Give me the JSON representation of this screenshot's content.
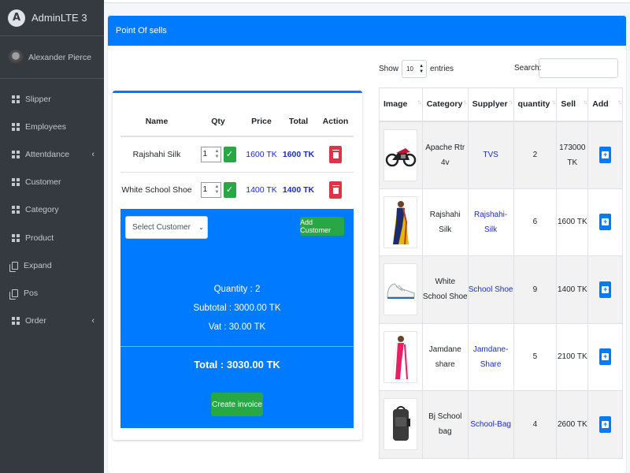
{
  "brand": {
    "logo_letter": "A",
    "name": "AdminLTE 3"
  },
  "user": {
    "name": "Alexander Pierce"
  },
  "sidebar": {
    "items": [
      {
        "label": "Slipper",
        "icon": "grid-icon",
        "has_chevron": false
      },
      {
        "label": "Employees",
        "icon": "grid-icon",
        "has_chevron": false
      },
      {
        "label": "Attentdance",
        "icon": "grid-icon",
        "has_chevron": true
      },
      {
        "label": "Customer",
        "icon": "grid-icon",
        "has_chevron": false
      },
      {
        "label": "Category",
        "icon": "grid-icon",
        "has_chevron": false
      },
      {
        "label": "Product",
        "icon": "grid-icon",
        "has_chevron": false
      },
      {
        "label": "Expand",
        "icon": "copy-icon",
        "has_chevron": false
      },
      {
        "label": "Pos",
        "icon": "copy-icon",
        "has_chevron": false
      },
      {
        "label": "Order",
        "icon": "grid-icon",
        "has_chevron": true
      }
    ],
    "chevron": "‹"
  },
  "page": {
    "title": "Point Of sells"
  },
  "cart": {
    "headers": {
      "name": "Name",
      "qty": "Qty",
      "price": "Price",
      "total": "Total",
      "action": "Action"
    },
    "rows": [
      {
        "name": "Rajshahi Silk",
        "qty": "1",
        "price": "1600 TK",
        "total": "1600 TK"
      },
      {
        "name": "White School Shoe",
        "qty": "1",
        "price": "1400 TK",
        "total": "1400 TK"
      }
    ],
    "select_customer": "Select Customer",
    "add_customer": "Add Customer",
    "quantity": "Quantity : 2",
    "subtotal": "Subtotal : 3000.00 TK",
    "vat": "Vat : 30.00 TK",
    "grand_total": "Total : 3030.00 TK",
    "create_invoice": "Create invoice"
  },
  "products": {
    "show_label": "Show",
    "entries_value": "10",
    "entries_label": "entries",
    "search_label": "Search:",
    "search_value": "",
    "headers": {
      "image": "Image",
      "category": "Category",
      "supplier": "Supplyer",
      "quantity": "quantity",
      "sell": "Sell",
      "add": "Add"
    },
    "rows": [
      {
        "image": "motorbike-image",
        "category": "Apache Rtr 4v",
        "supplier": "TVS",
        "quantity": "2",
        "sell": "173000 TK"
      },
      {
        "image": "saree-image",
        "category": "Rajshahi Silk",
        "supplier": "Rajshahi-Silk",
        "quantity": "6",
        "sell": "1600 TK"
      },
      {
        "image": "shoe-image",
        "category": "White School Shoe",
        "supplier": "School Shoe",
        "quantity": "9",
        "sell": "1400 TK"
      },
      {
        "image": "saree-image",
        "category": "Jamdane share",
        "supplier": "Jamdane-Share",
        "quantity": "5",
        "sell": "2100 TK"
      },
      {
        "image": "bag-image",
        "category": "Bj School bag",
        "supplier": "School-Bag",
        "quantity": "4",
        "sell": "2600 TK"
      }
    ]
  },
  "colors": {
    "primary": "#007bff",
    "success": "#28a745",
    "danger": "#dc3545",
    "sidebar": "#343a40",
    "link": "#1a2bd1"
  }
}
